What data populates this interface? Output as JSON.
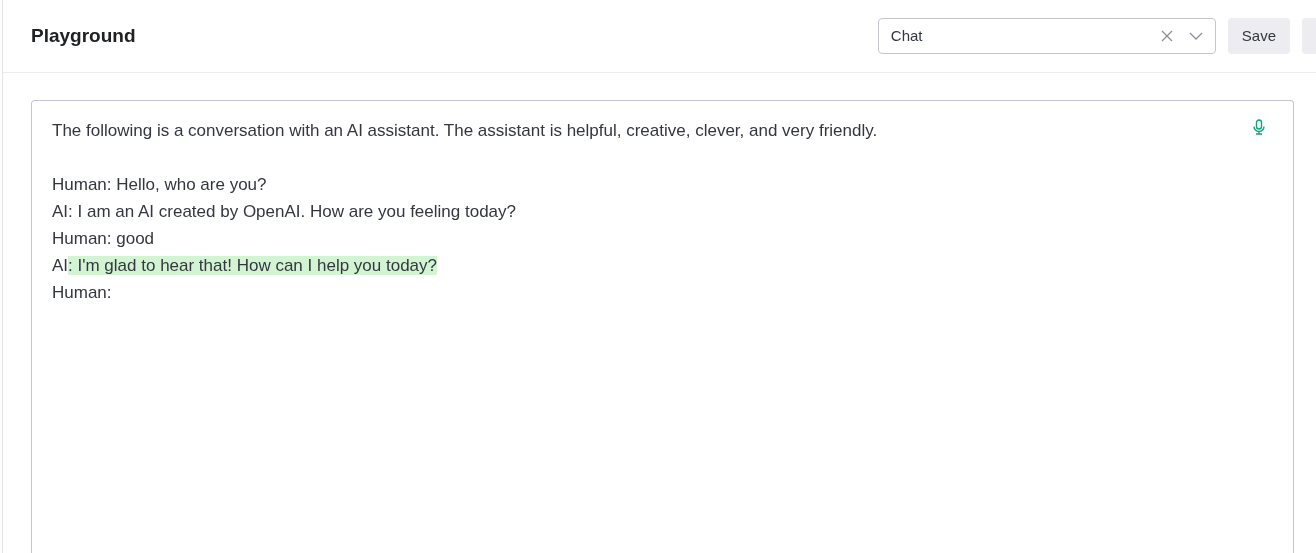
{
  "header": {
    "title": "Playground",
    "mode_select": {
      "value": "Chat"
    },
    "buttons": [
      "Save"
    ]
  },
  "editor": {
    "paragraphs": [
      {
        "lines": [
          {
            "segments": [
              {
                "text": "The following is a conversation with an AI assistant. The assistant is helpful, creative, clever, and very friendly.",
                "highlighted": false
              }
            ]
          }
        ]
      },
      {
        "lines": [
          {
            "segments": [
              {
                "text": "Human: Hello, who are you?",
                "highlighted": false
              }
            ]
          },
          {
            "segments": [
              {
                "text": "AI: I am an AI created by OpenAI. How are you feeling today?",
                "highlighted": false
              }
            ]
          },
          {
            "segments": [
              {
                "text": "Human: good",
                "highlighted": false
              }
            ]
          },
          {
            "segments": [
              {
                "text": "AI",
                "highlighted": false
              },
              {
                "text": ": I'm glad to hear that! How can I help you today?",
                "highlighted": true
              }
            ]
          },
          {
            "segments": [
              {
                "text": "Human:",
                "highlighted": false
              }
            ]
          }
        ]
      }
    ]
  }
}
